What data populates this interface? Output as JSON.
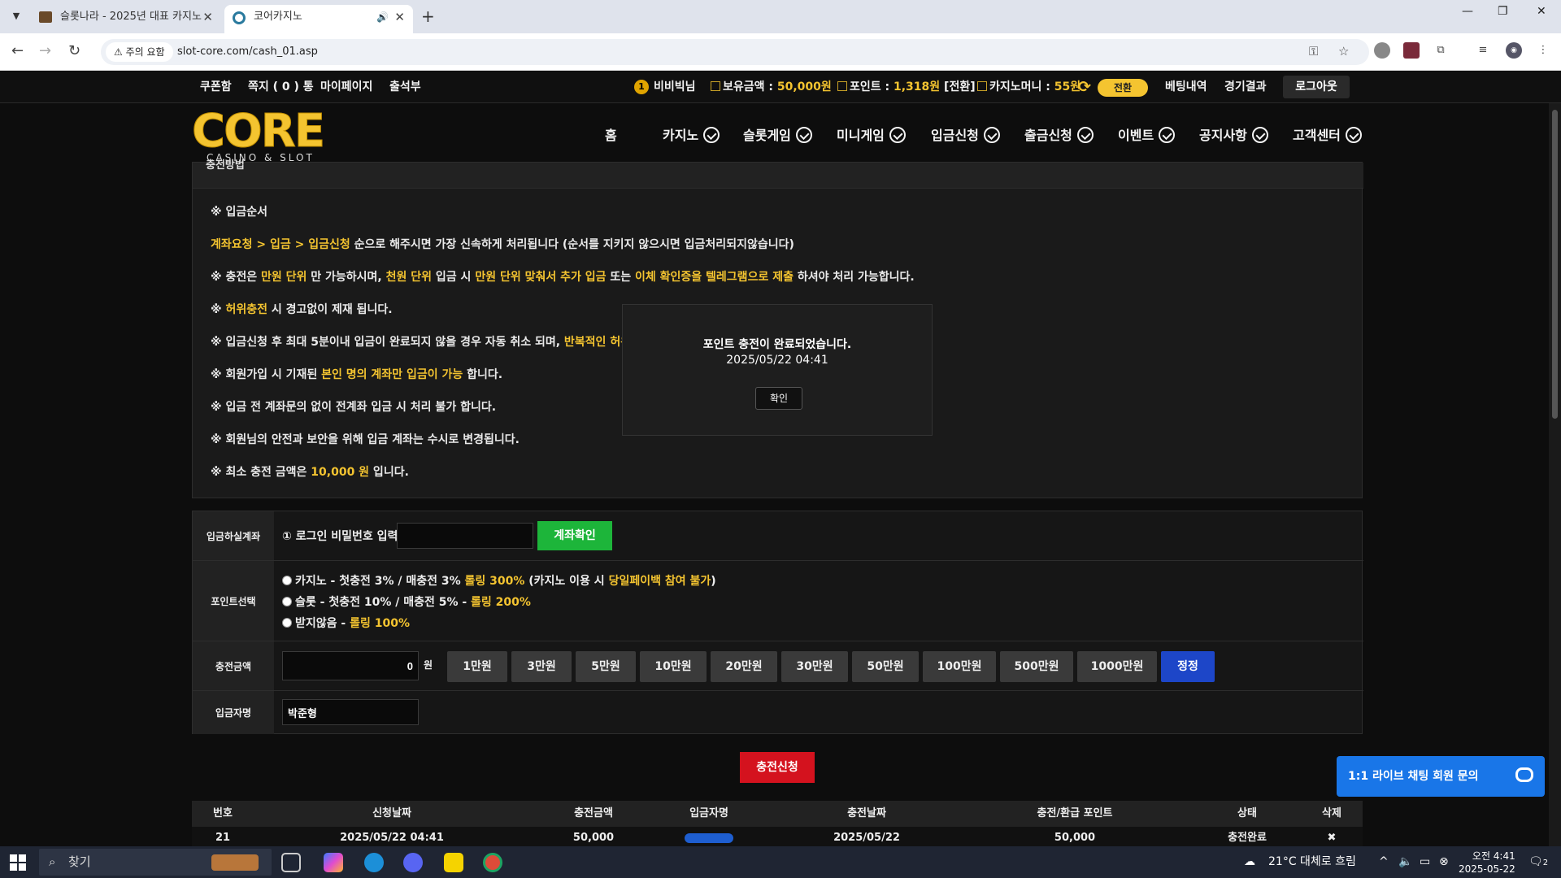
{
  "browser": {
    "tabs": [
      {
        "title": "슬롯나라 - 2025년 대표 카지노"
      },
      {
        "title": "코어카지노"
      }
    ],
    "warning_chip": "주의 요함",
    "url": "slot-core.com/cash_01.asp"
  },
  "topbar": {
    "links": [
      "쿠폰함",
      "쪽지 ( 0 ) 통",
      "마이페이지",
      "출석부"
    ],
    "username": "비비빅님",
    "balance_label": "보유금액 :",
    "balance_value": "50,000원",
    "point_label": "포인트 :",
    "point_value": "1,318원",
    "point_convert": "[전환]",
    "casino_money_label": "카지노머니 :",
    "casino_money_value": "55원",
    "convert_button": "전환",
    "bet_history": "베팅내역",
    "game_results": "경기결과",
    "logout": "로그아웃"
  },
  "logo": {
    "main": "CORE",
    "sub": "CASINO & SLOT"
  },
  "nav": [
    "홈",
    "카지노",
    "슬롯게임",
    "미니게임",
    "입금신청",
    "출금신청",
    "이벤트",
    "공지사항",
    "고객센터"
  ],
  "notice": {
    "heading": "충전방법",
    "line1": "※ 입금순서",
    "line2_highlight": "계좌요청 > 입금 > 입금신청",
    "line2_rest": " 순으로 해주시면 가장 신속하게 처리됩니다 (순서를 지키지 않으시면 입금처리되지않습니다)",
    "line3_a": "※ 충전은 ",
    "line3_b": "만원 단위",
    "line3_c": " 만 가능하시며, ",
    "line3_d": "천원 단위",
    "line3_e": " 입금 시 ",
    "line3_f": "만원 단위 맞춰서 추가 입금",
    "line3_g": " 또는 ",
    "line3_h": "이체 확인증을 텔레그램으로 제출",
    "line3_i": " 하셔야 처리 가능합니다.",
    "line4_a": "※ ",
    "line4_b": "허위충전",
    "line4_c": " 시 경고없이 제재 됩니다.",
    "line5_a": "※ 입금신청 후 최대 5분이내 입금이 완료되지 않을 경우 자동 취소 되며, ",
    "line5_b": "반복적인 허위 입",
    "line6_a": "※ 회원가입 시 기재된 ",
    "line6_b": "본인 명의 계좌만 입금이 가능",
    "line6_c": " 합니다.",
    "line7": "※ 입금 전 계좌문의 없이 전계좌 입금 시 처리 불가 합니다.",
    "line8": "※ 회원님의 안전과 보안을 위해 입금 계좌는 수시로 변경됩니다.",
    "line9_a": "※ 최소 충전 금액은 ",
    "line9_b": "10,000 원",
    "line9_c": " 입니다."
  },
  "modal": {
    "message": "포인트 충전이 완료되었습니다.",
    "time": "2025/05/22 04:41",
    "ok": "확인"
  },
  "form": {
    "account_label": "입금하실계좌",
    "password_prompt": "① 로그인 비밀번호 입력",
    "password_value": "",
    "check_button": "계좌확인",
    "point_label": "포인트선택",
    "options": [
      {
        "a": "카지노 - 첫충전 3% / 매충전 3% ",
        "b": "롤링 300%",
        "c": " (카지노 이용 시 ",
        "d": "당일페이백 참여 불가",
        "e": ")"
      },
      {
        "a": "슬롯 - 첫충전 10% / 매충전 5% - ",
        "b": "롤링 200%"
      },
      {
        "a": "받지않음 - ",
        "b": "롤링 100%"
      }
    ],
    "amount_label": "충전금액",
    "amount_value": "0",
    "amount_unit": "원",
    "amount_buttons": [
      "1만원",
      "3만원",
      "5만원",
      "10만원",
      "20만원",
      "30만원",
      "50만원",
      "100만원",
      "500만원",
      "1000만원"
    ],
    "reset_button": "정정",
    "depositor_label": "입금자명",
    "depositor_value": "박준형"
  },
  "submit_button": "충전신청",
  "history": {
    "headers": [
      "번호",
      "신청날짜",
      "충전금액",
      "입금자명",
      "충전날짜",
      "충전/환급 포인트",
      "상태",
      "삭제"
    ],
    "rows": [
      {
        "no": "21",
        "request_date": "2025/05/22 04:41",
        "amount": "50,000",
        "depositor": "",
        "charge_date": "2025/05/22",
        "points": "50,000",
        "status": "충전완료",
        "delete": "✖"
      }
    ]
  },
  "chat_widget": "1:1 라이브 채팅 회원 문의",
  "taskbar": {
    "search": "찾기",
    "weather": "21°C  대체로 흐림",
    "time": "오전 4:41",
    "date": "2025-05-22",
    "notification_count": "2"
  }
}
